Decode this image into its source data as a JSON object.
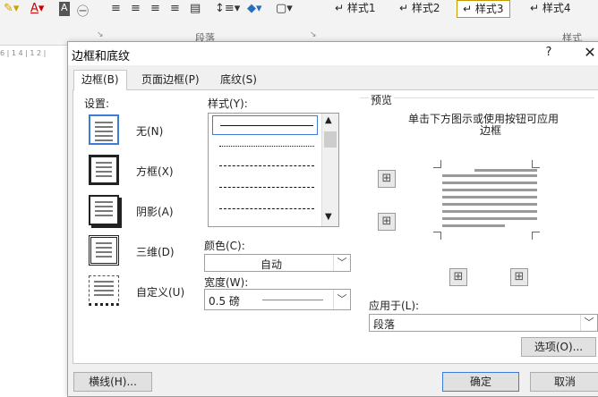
{
  "ribbon": {
    "styles": [
      "↵ 样式1",
      "↵ 样式2",
      "↵ 样式3",
      "↵ 样式4"
    ],
    "paragraph_group": "段落",
    "styles_group": "样式",
    "ruler_text": "6 | 1 4 | 1 2 |"
  },
  "dialog": {
    "title": "边框和底纹",
    "help": "?",
    "close": "✕",
    "tabs": [
      "边框(B)",
      "页面边框(P)",
      "底纹(S)"
    ],
    "settings_label": "设置:",
    "settings": [
      "无(N)",
      "方框(X)",
      "阴影(A)",
      "三维(D)",
      "自定义(U)"
    ],
    "style_label": "样式(Y):",
    "color_label": "颜色(C):",
    "color_value": "自动",
    "width_label": "宽度(W):",
    "width_value": "0.5 磅",
    "preview_label": "预览",
    "preview_hint_line1": "单击下方图示或使用按钮可应用",
    "preview_hint_line2": "边框",
    "apply_label": "应用于(L):",
    "apply_value": "段落",
    "options_button": "选项(O)...",
    "hline_button": "横线(H)...",
    "ok_button": "确定",
    "cancel_button": "取消"
  }
}
